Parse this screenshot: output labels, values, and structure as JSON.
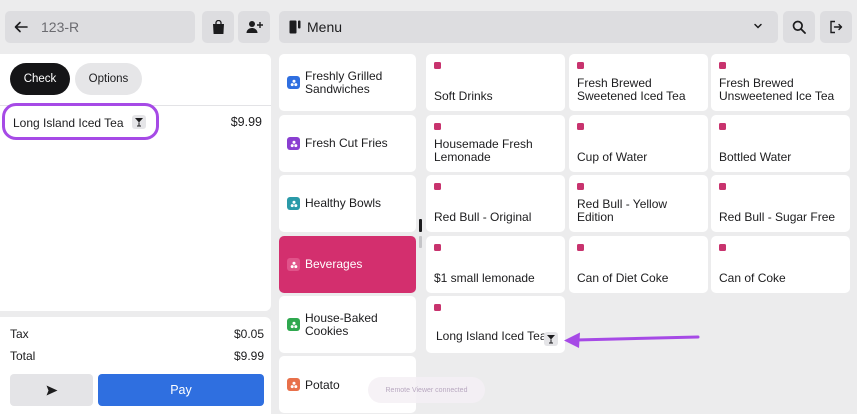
{
  "header": {
    "order_number": "123-R",
    "menu_title": "Menu"
  },
  "check": {
    "tabs": [
      {
        "label": "Check"
      },
      {
        "label": "Options"
      }
    ],
    "line_items": [
      {
        "name": "Long Island Iced Tea",
        "price": "$9.99",
        "icon": "cocktail-icon"
      }
    ],
    "tax_label": "Tax",
    "tax_value": "$0.05",
    "total_label": "Total",
    "total_value": "$9.99",
    "pay_label": "Pay"
  },
  "categories": [
    {
      "label": "Freshly Grilled Sandwiches",
      "color": "#2f6fe0"
    },
    {
      "label": "Fresh Cut Fries",
      "color": "#8a3fd1"
    },
    {
      "label": "Healthy Bowls",
      "color": "#2a9aa8"
    },
    {
      "label": "Beverages",
      "color": "#e0538a",
      "active": true
    },
    {
      "label": "House-Baked Cookies",
      "color": "#2fa84f"
    },
    {
      "label": "Potato",
      "color": "#e8704a"
    }
  ],
  "items": [
    {
      "label": "Soft Drinks"
    },
    {
      "label": "Fresh Brewed Sweetened Iced Tea"
    },
    {
      "label": "Fresh Brewed Unsweetened Ice Tea"
    },
    {
      "label": "Housemade Fresh Lemonade"
    },
    {
      "label": "Cup of Water"
    },
    {
      "label": "Bottled Water"
    },
    {
      "label": "Red Bull - Original"
    },
    {
      "label": "Red Bull - Yellow Edition"
    },
    {
      "label": "Red Bull - Sugar Free"
    },
    {
      "label": "$1 small lemonade"
    },
    {
      "label": "Can of Diet Coke"
    },
    {
      "label": "Can of Coke"
    },
    {
      "label": "Long Island Iced Tea",
      "icon": "cocktail-icon"
    }
  ],
  "colors": {
    "accent_pink": "#d32f6e",
    "pay_blue": "#2f6fe0",
    "annotation_purple": "#a64ae6"
  },
  "toast": {
    "text": "Remote Viewer connected"
  }
}
